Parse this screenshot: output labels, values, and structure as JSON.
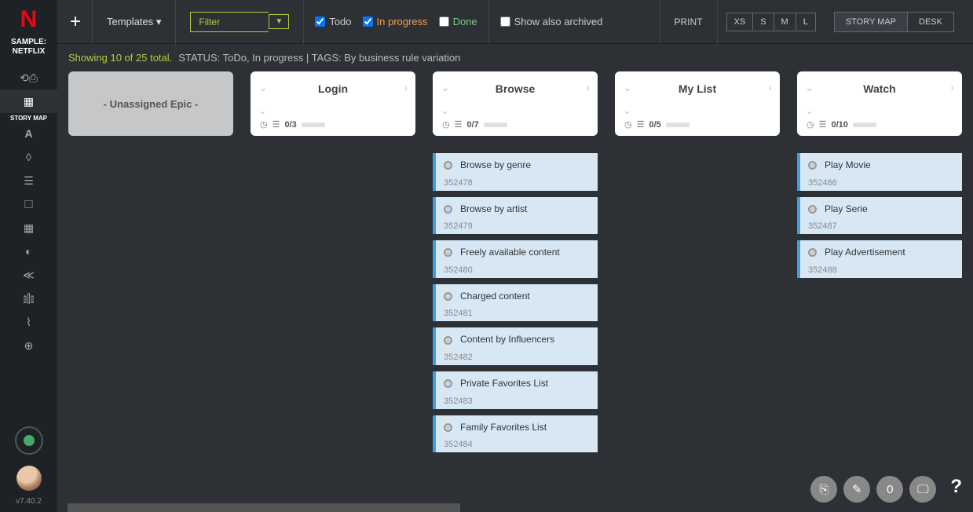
{
  "logo": "N",
  "project_name": "SAMPLE:\nNETFLIX",
  "active_nav": "STORY MAP",
  "version": "v7.40.2",
  "toolbar": {
    "templates": "Templates ▾",
    "filter_placeholder": "Filter",
    "todo": "Todo",
    "inprogress": "In progress",
    "done": "Done",
    "archived": "Show also archived",
    "print": "PRINT",
    "sizes": [
      "XS",
      "S",
      "M",
      "L"
    ],
    "storymap": "STORY MAP",
    "desk": "DESK"
  },
  "status": {
    "showing": "Showing 10 of 25 total.",
    "filters": "STATUS: ToDo, In progress  |  TAGS: By business rule variation"
  },
  "columns": [
    {
      "title": "- Unassigned Epic -",
      "kind": "unassigned",
      "count": "",
      "cards": []
    },
    {
      "title": "Login",
      "kind": "epic",
      "count": "0/3",
      "cards": []
    },
    {
      "title": "Browse",
      "kind": "epic",
      "count": "0/7",
      "cards": [
        {
          "title": "Browse by genre",
          "id": "352478"
        },
        {
          "title": "Browse by artist",
          "id": "352479"
        },
        {
          "title": "Freely available content",
          "id": "352480"
        },
        {
          "title": "Charged content",
          "id": "352481"
        },
        {
          "title": "Content by Influencers",
          "id": "352482"
        },
        {
          "title": "Private Favorites List",
          "id": "352483"
        },
        {
          "title": "Family Favorites List",
          "id": "352484"
        }
      ]
    },
    {
      "title": "My List",
      "kind": "epic",
      "count": "0/5",
      "cards": []
    },
    {
      "title": "Watch",
      "kind": "epic",
      "count": "0/10",
      "cards": [
        {
          "title": "Play Movie",
          "id": "352486"
        },
        {
          "title": "Play Serie",
          "id": "352487"
        },
        {
          "title": "Play Advertisement",
          "id": "352488"
        }
      ]
    }
  ],
  "bottom_count": "0"
}
